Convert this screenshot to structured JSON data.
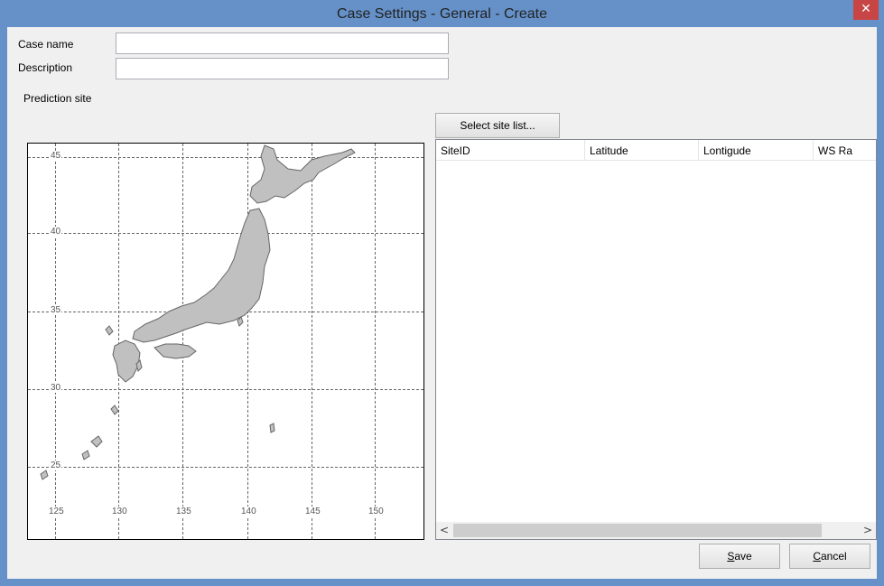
{
  "window": {
    "title": "Case Settings - General - Create",
    "close_glyph": "✕"
  },
  "form": {
    "case_name_label": "Case name",
    "case_name_value": "",
    "description_label": "Description",
    "description_value": "",
    "prediction_site_label": "Prediction site",
    "select_site_button": "Select site list..."
  },
  "map": {
    "longitude_ticks": [
      "125",
      "130",
      "135",
      "140",
      "145",
      "150"
    ],
    "latitude_ticks": [
      "45",
      "40",
      "35",
      "30",
      "25"
    ],
    "land_color": "#c0c0c0",
    "coast_color": "#666666"
  },
  "site_list": {
    "columns": [
      "SiteID",
      "Latitude",
      "Lontigude",
      "WS Ra"
    ],
    "rows": []
  },
  "scrollbar": {
    "left_icon": "chevron-left-icon",
    "right_icon": "chevron-right-icon",
    "left_glyph": "<",
    "right_glyph": ">"
  },
  "buttons": {
    "save_mnemonic": "S",
    "save_rest": "ave",
    "cancel_mnemonic": "C",
    "cancel_rest": "ancel"
  }
}
